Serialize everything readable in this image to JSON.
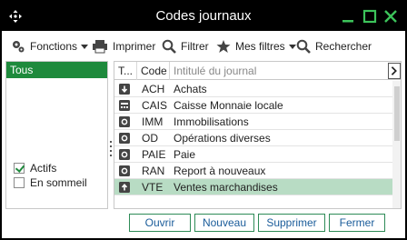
{
  "window": {
    "title": "Codes journaux"
  },
  "toolbar": {
    "fonctions": "Fonctions",
    "imprimer": "Imprimer",
    "filtrer": "Filtrer",
    "mes_filtres": "Mes filtres",
    "rechercher": "Rechercher"
  },
  "left_panel": {
    "filter_selected": "Tous",
    "actifs": {
      "label": "Actifs",
      "checked": true
    },
    "en_sommeil": {
      "label": "En sommeil",
      "checked": false
    }
  },
  "grid": {
    "columns": [
      "T...",
      "Code",
      "Intitulé du journal"
    ],
    "rows": [
      {
        "type_icon": "purchase-arrow-icon",
        "code": "ACH",
        "label": "Achats"
      },
      {
        "type_icon": "cash-register-icon",
        "code": "CAIS",
        "label": "Caisse Monnaie locale"
      },
      {
        "type_icon": "general-journal-icon",
        "code": "IMM",
        "label": "Immobilisations"
      },
      {
        "type_icon": "general-journal-icon",
        "code": "OD",
        "label": "Opérations diverses"
      },
      {
        "type_icon": "general-journal-icon",
        "code": "PAIE",
        "label": "Paie"
      },
      {
        "type_icon": "general-journal-icon",
        "code": "RAN",
        "label": "Report à nouveaux"
      },
      {
        "type_icon": "sales-arrow-icon",
        "code": "VTE",
        "label": "Ventes marchandises",
        "selected": true
      }
    ]
  },
  "buttons": {
    "ouvrir": "Ouvrir",
    "nouveau": "Nouveau",
    "supprimer": "Supprimer",
    "fermer": "Fermer"
  },
  "colors": {
    "accent_green": "#1e8a3c",
    "selected_row": "#b8dcc4",
    "title_bar": "#000000",
    "button_text": "#1a5c9a"
  }
}
